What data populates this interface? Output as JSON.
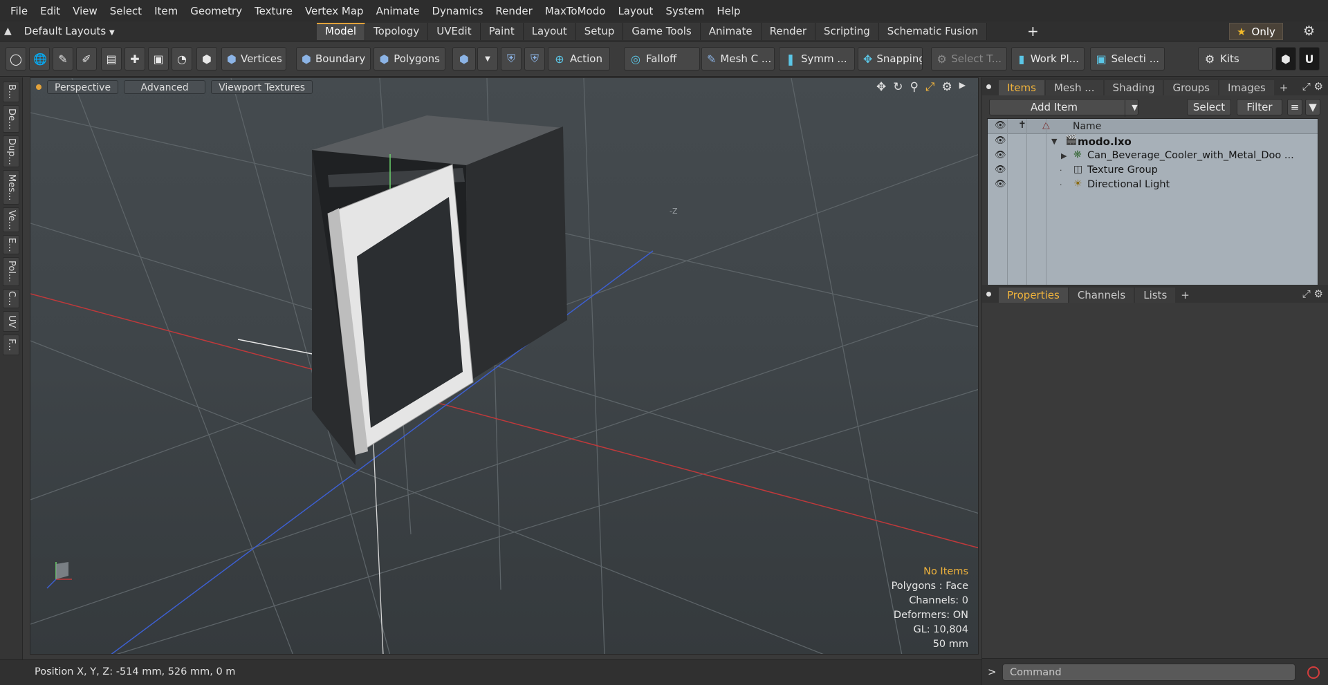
{
  "menu": [
    "File",
    "Edit",
    "View",
    "Select",
    "Item",
    "Geometry",
    "Texture",
    "Vertex Map",
    "Animate",
    "Dynamics",
    "Render",
    "MaxToModo",
    "Layout",
    "System",
    "Help"
  ],
  "layout_dropdown": "Default Layouts",
  "tabs": [
    "Model",
    "Topology",
    "UVEdit",
    "Paint",
    "Layout",
    "Setup",
    "Game Tools",
    "Animate",
    "Render",
    "Scripting",
    "Schematic Fusion"
  ],
  "active_tab": "Model",
  "only_label": "Only",
  "toolbar": {
    "vertices": "Vertices",
    "boundary": "Boundary",
    "polygons": "Polygons",
    "action": "Action",
    "falloff": "Falloff",
    "mesh_c": "Mesh C ...",
    "symm": "Symm ...",
    "snapping": "Snapping",
    "select_t": "Select T...",
    "work_pl": "Work Pl...",
    "selecti": "Selecti ...",
    "kits": "Kits"
  },
  "left_tabs": [
    "B...",
    "De...",
    "Dup...",
    "Mes...",
    "Ve...",
    "E...",
    "Pol...",
    "C...",
    "UV",
    "F..."
  ],
  "viewport": {
    "header": [
      "Perspective",
      "Advanced",
      "Viewport Textures"
    ],
    "axis_label": "-Z",
    "info": {
      "selection": "No Items",
      "polygons": "Polygons : Face",
      "channels": "Channels: 0",
      "deformers": "Deformers: ON",
      "gl": "GL: 10,804",
      "scale": "50 mm"
    }
  },
  "status": {
    "position": "Position X, Y, Z:   -514 mm, 526 mm, 0 m"
  },
  "items_panel": {
    "tabs": [
      "Items",
      "Mesh ...",
      "Shading",
      "Groups",
      "Images"
    ],
    "active_tab": "Items",
    "add_item": "Add Item",
    "select_btn": "Select",
    "filter_btn": "Filter",
    "column_name": "Name",
    "rows": [
      {
        "name": "modo.lxo"
      },
      {
        "name": "Can_Beverage_Cooler_with_Metal_Doo ..."
      },
      {
        "name": "Texture Group"
      },
      {
        "name": "Directional Light"
      }
    ]
  },
  "properties_panel": {
    "tabs": [
      "Properties",
      "Channels",
      "Lists"
    ],
    "active_tab": "Properties"
  },
  "command": {
    "prompt": ">",
    "placeholder": "Command"
  },
  "colors": {
    "accent": "#e2a23a",
    "x_axis": "#c0393b",
    "y_axis": "#6cd36c",
    "z_axis": "#3d5fd0"
  }
}
